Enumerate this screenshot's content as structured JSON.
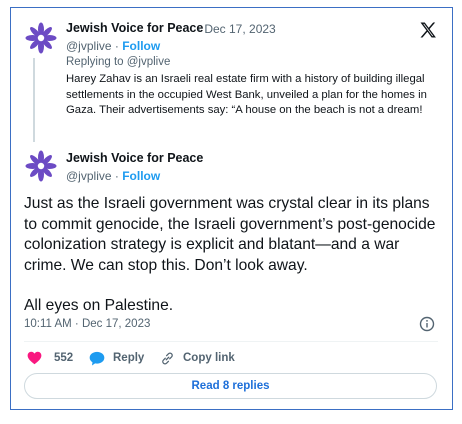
{
  "colors": {
    "accent": "#1d9bf0",
    "like": "#f91880",
    "avatar": "#6c4bc4",
    "frame": "#3b6fc4"
  },
  "quoted_tweet": {
    "author": "Jewish Voice for Peace",
    "date": "· Dec 17, 2023",
    "handle": "@jvplive ·",
    "follow": "Follow",
    "replying_to": "Replying to @jvplive",
    "text": "Harey Zahav is an Israeli real estate firm with a history of building illegal settlements in the occupied West Bank, unveiled a plan for the homes in Gaza. Their advertisements say: “A house on the beach is not a dream!"
  },
  "main_tweet": {
    "author": "Jewish Voice for Peace",
    "handle": "@jvplive ·",
    "follow": "Follow",
    "text": "Just as the Israeli government was crystal clear in its plans to commit genocide, the Israeli government’s post-genocide colonization strategy is explicit and blatant—and a war crime. We can stop this. Don’t look away.",
    "text2": "All eyes on Palestine.",
    "timestamp": "10:11 AM · Dec 17, 2023"
  },
  "actions": {
    "likes": "552",
    "reply": "Reply",
    "copy_link": "Copy link"
  },
  "read_replies": "Read 8 replies",
  "icons": [
    "star-logo-icon",
    "x-logo-icon",
    "info-icon",
    "heart-icon",
    "reply-bubble-icon",
    "link-icon"
  ]
}
